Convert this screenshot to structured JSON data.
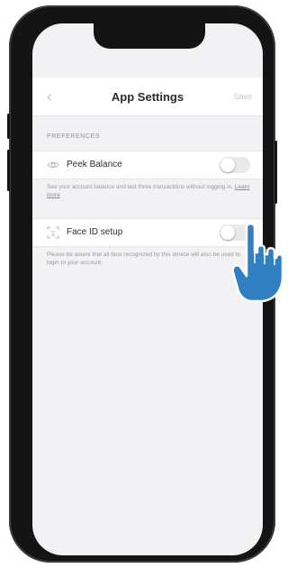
{
  "header": {
    "title": "App Settings",
    "save_label": "Save"
  },
  "preferences": {
    "section_label": "PREFERENCES",
    "items": [
      {
        "label": "Peek Balance",
        "icon": "eye-icon",
        "enabled": false,
        "description": "See your account balance and last three transactions without logging in.",
        "link_label": "Learn more"
      },
      {
        "label": "Face ID setup",
        "icon": "face-id-icon",
        "enabled": false,
        "description": "Please be aware that all face recognized by this device will also be used to login to your account."
      }
    ]
  },
  "colors": {
    "background": "#f2f2f4",
    "toggle_off": "#e9e9ec",
    "pointer_hand": "#2f7fc1"
  }
}
